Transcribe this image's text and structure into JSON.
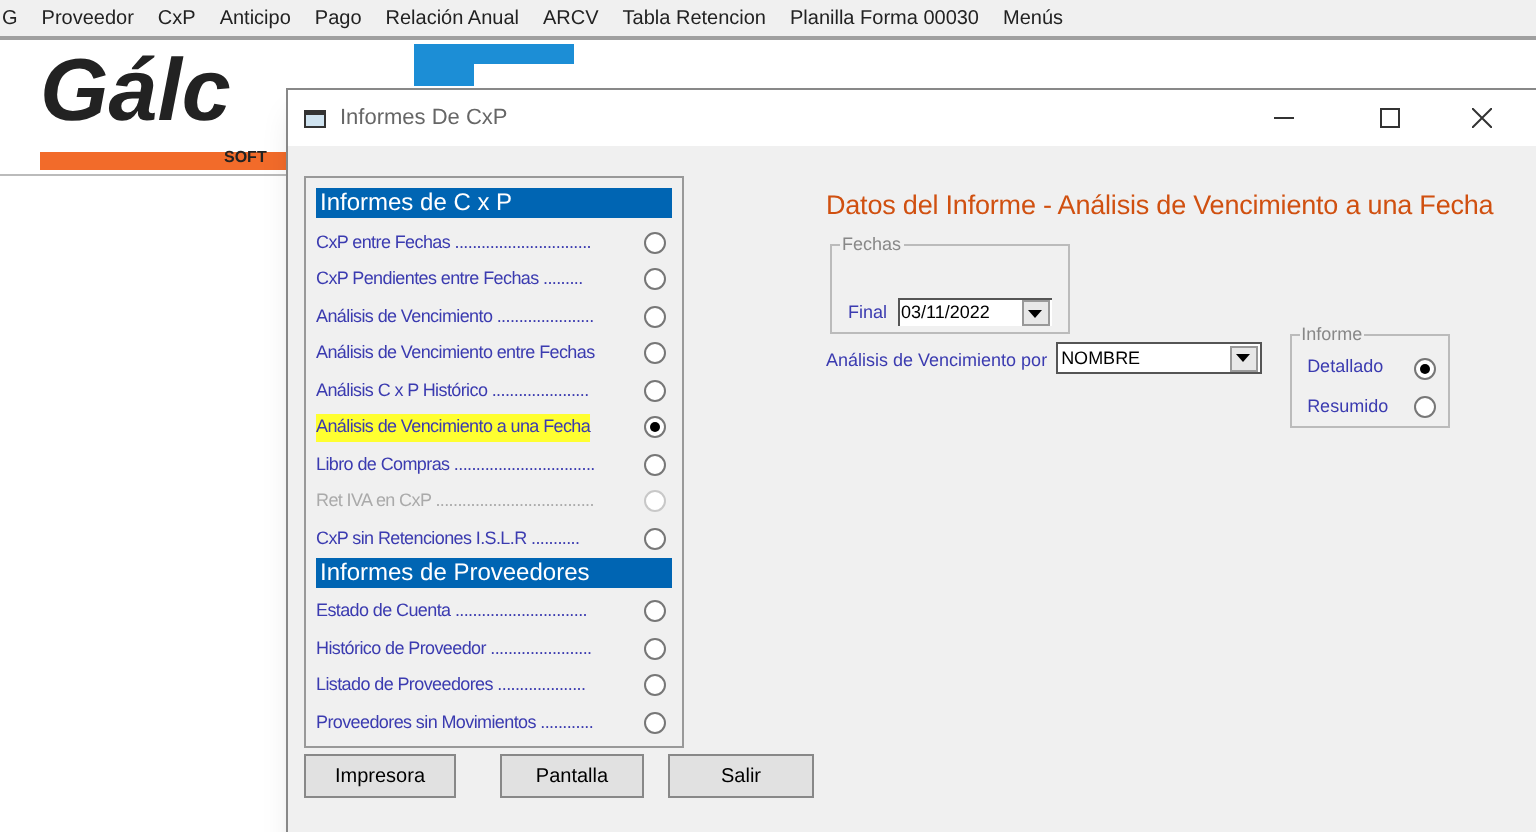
{
  "menu_bar": [
    "G",
    "Proveedor",
    "CxP",
    "Anticipo",
    "Pago",
    "Relación Anual",
    "ARCV",
    "Tabla Retencion",
    "Planilla Forma 00030",
    "Menús"
  ],
  "banner": {
    "logo_text": "Gálc",
    "logo_sub": "SOFT"
  },
  "dialog": {
    "title": "Informes De CxP",
    "sections": [
      {
        "heading": "Informes de C x P",
        "items": [
          {
            "label": "CxP entre Fechas ...............................",
            "selected": false,
            "disabled": false,
            "highlighted": false
          },
          {
            "label": "CxP Pendientes entre Fechas .........",
            "selected": false,
            "disabled": false,
            "highlighted": false
          },
          {
            "label": "Análisis de Vencimiento ......................",
            "selected": false,
            "disabled": false,
            "highlighted": false
          },
          {
            "label": "Análisis de Vencimiento entre Fechas",
            "selected": false,
            "disabled": false,
            "highlighted": false
          },
          {
            "label": "Análisis C x P Histórico ......................",
            "selected": false,
            "disabled": false,
            "highlighted": false
          },
          {
            "label": "Análisis de Vencimiento a una Fecha",
            "selected": true,
            "disabled": false,
            "highlighted": true
          },
          {
            "label": "Libro de Compras ................................",
            "selected": false,
            "disabled": false,
            "highlighted": false
          },
          {
            "label": "Ret IVA en CxP ....................................",
            "selected": false,
            "disabled": true,
            "highlighted": false
          },
          {
            "label": "CxP sin Retenciones I.S.L.R ...........",
            "selected": false,
            "disabled": false,
            "highlighted": false
          }
        ]
      },
      {
        "heading": "Informes de Proveedores",
        "items": [
          {
            "label": "Estado de Cuenta ..............................",
            "selected": false,
            "disabled": false,
            "highlighted": false
          },
          {
            "label": "Histórico de Proveedor .......................",
            "selected": false,
            "disabled": false,
            "highlighted": false
          },
          {
            "label": "Listado de Proveedores ....................",
            "selected": false,
            "disabled": false,
            "highlighted": false
          },
          {
            "label": "Proveedores sin Movimientos ............",
            "selected": false,
            "disabled": false,
            "highlighted": false
          }
        ]
      }
    ],
    "report_title": "Datos del Informe - Análisis de Vencimiento a una Fecha",
    "fechas": {
      "legend": "Fechas",
      "label": "Final",
      "value": "03/11/2022"
    },
    "analysis_by": {
      "label": "Análisis de Vencimiento por",
      "value": "NOMBRE"
    },
    "informe": {
      "legend": "Informe",
      "options": [
        {
          "label": "Detallado",
          "selected": true
        },
        {
          "label": "Resumido",
          "selected": false
        }
      ]
    },
    "buttons": [
      "Impresora",
      "Pantalla",
      "Salir"
    ]
  }
}
